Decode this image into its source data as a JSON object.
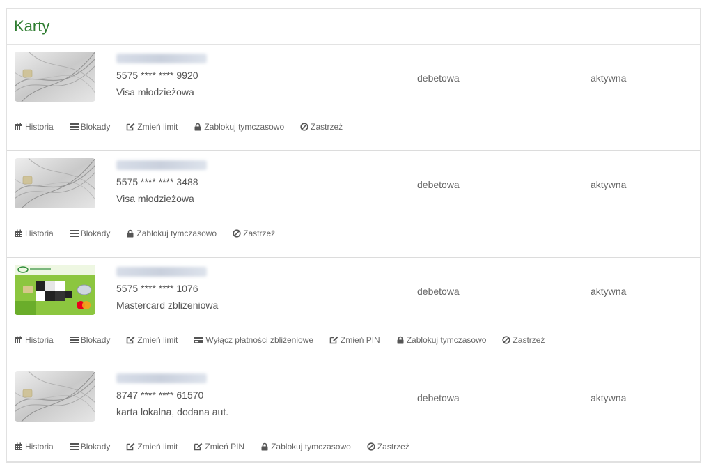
{
  "panel": {
    "title": "Karty"
  },
  "cards": [
    {
      "number": "5575 **** **** 9920",
      "type": "Visa młodzieżowa",
      "kind": "debetowa",
      "status": "aktywna",
      "image": "gray-card",
      "actions": [
        {
          "label": "Historia",
          "icon": "calendar-icon"
        },
        {
          "label": "Blokady",
          "icon": "list-icon"
        },
        {
          "label": "Zmień limit",
          "icon": "edit-icon"
        },
        {
          "label": "Zablokuj tymczasowo",
          "icon": "lock-icon"
        },
        {
          "label": "Zastrzeż",
          "icon": "ban-icon"
        }
      ]
    },
    {
      "number": "5575 **** **** 3488",
      "type": "Visa młodzieżowa",
      "kind": "debetowa",
      "status": "aktywna",
      "image": "gray-card",
      "actions": [
        {
          "label": "Historia",
          "icon": "calendar-icon"
        },
        {
          "label": "Blokady",
          "icon": "list-icon"
        },
        {
          "label": "Zablokuj tymczasowo",
          "icon": "lock-icon"
        },
        {
          "label": "Zastrzeż",
          "icon": "ban-icon"
        }
      ]
    },
    {
      "number": "5575 **** **** 1076",
      "type": "Mastercard zbliżeniowa",
      "kind": "debetowa",
      "status": "aktywna",
      "image": "green-card",
      "actions": [
        {
          "label": "Historia",
          "icon": "calendar-icon"
        },
        {
          "label": "Blokady",
          "icon": "list-icon"
        },
        {
          "label": "Zmień limit",
          "icon": "edit-icon"
        },
        {
          "label": "Wyłącz płatności zbliżeniowe",
          "icon": "card-icon"
        },
        {
          "label": "Zmień PIN",
          "icon": "edit-icon"
        },
        {
          "label": "Zablokuj tymczasowo",
          "icon": "lock-icon"
        },
        {
          "label": "Zastrzeż",
          "icon": "ban-icon"
        }
      ]
    },
    {
      "number": "8747 **** **** 61570",
      "type": "karta lokalna, dodana aut.",
      "kind": "debetowa",
      "status": "aktywna",
      "image": "gray-card",
      "actions": [
        {
          "label": "Historia",
          "icon": "calendar-icon"
        },
        {
          "label": "Blokady",
          "icon": "list-icon"
        },
        {
          "label": "Zmień limit",
          "icon": "edit-icon"
        },
        {
          "label": "Zmień PIN",
          "icon": "edit-icon"
        },
        {
          "label": "Zablokuj tymczasowo",
          "icon": "lock-icon"
        },
        {
          "label": "Zastrzeż",
          "icon": "ban-icon"
        }
      ]
    }
  ],
  "colors": {
    "title": "#2f7d31",
    "border": "#e1e1e1",
    "text": "#555555",
    "icon": "#555555"
  }
}
